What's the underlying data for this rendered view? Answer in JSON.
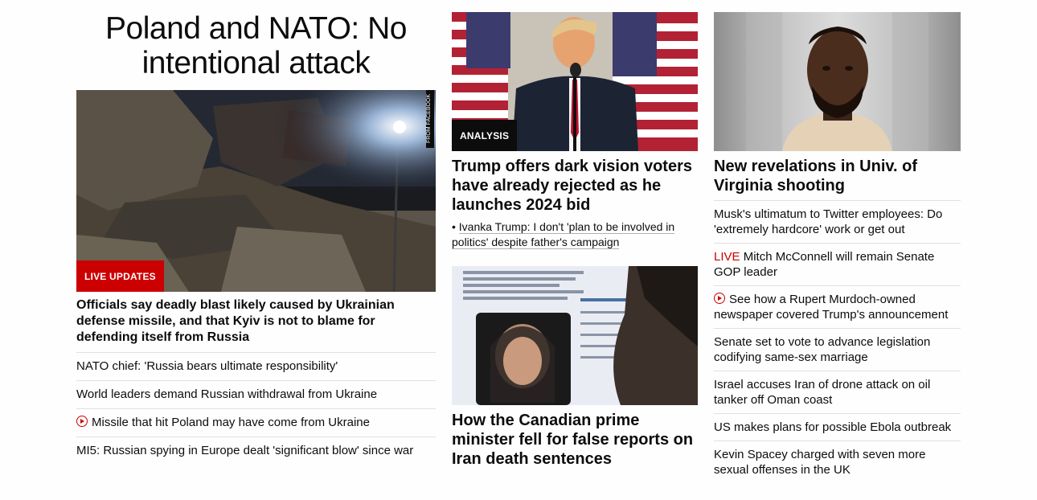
{
  "col1": {
    "headline": "Poland and NATO: No intentional attack",
    "image_credit": "FROM FACEBOOK",
    "badge": "LIVE UPDATES",
    "lead_title": "Officials say deadly blast likely caused by Ukrainian defense missile, and that Kyiv is not to blame for defending itself from Russia",
    "links": [
      "NATO chief: 'Russia bears ultimate responsibility'",
      "World leaders demand Russian withdrawal from Ukraine",
      "Missile that hit Poland may have come from Ukraine",
      "MI5: Russian spying in Europe dealt 'significant blow' since war"
    ]
  },
  "col2": {
    "story1": {
      "badge": "ANALYSIS",
      "title": "Trump offers dark vision voters have already rejected as he launches 2024 bid",
      "sub_bullet": "•",
      "sub_link": "Ivanka Trump: I don't 'plan to be involved in politics' despite father's campaign"
    },
    "story2": {
      "title": "How the Canadian prime minister fell for false reports on Iran death sentences"
    }
  },
  "col3": {
    "title": "New revelations in Univ. of Virginia shooting",
    "live_label": "LIVE",
    "links": [
      "Musk's ultimatum to Twitter employees: Do 'extremely hardcore' work or get out",
      "Mitch McConnell will remain Senate GOP leader",
      "See how a Rupert Murdoch-owned newspaper covered Trump's announcement",
      "Senate set to vote to advance legislation codifying same-sex marriage",
      "Israel accuses Iran of drone attack on oil tanker off Oman coast",
      "US makes plans for possible Ebola outbreak",
      "Kevin Spacey charged with seven more sexual offenses in the UK"
    ]
  }
}
